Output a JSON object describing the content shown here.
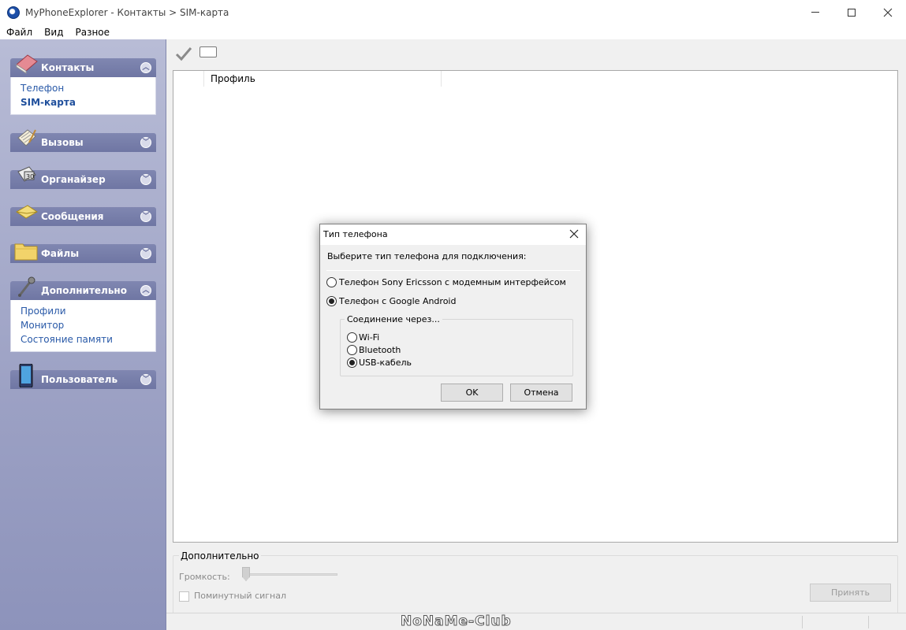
{
  "window": {
    "title": "MyPhoneExplorer -  Контакты > SIM-карта",
    "controls": {
      "minimize": "—",
      "maximize": "☐",
      "close": "✕"
    }
  },
  "menu": [
    "Файл",
    "Вид",
    "Разное"
  ],
  "sidebar": {
    "groups": [
      {
        "label": "Контакты",
        "expanded": true,
        "items": [
          {
            "label": "Телефон",
            "active": false
          },
          {
            "label": "SIM-карта",
            "active": true
          }
        ],
        "icon": "contacts-book-icon"
      },
      {
        "label": "Вызовы",
        "expanded": false,
        "items": [],
        "icon": "calls-notepad-icon"
      },
      {
        "label": "Органайзер",
        "expanded": false,
        "items": [],
        "icon": "organizer-calendar-icon"
      },
      {
        "label": "Сообщения",
        "expanded": false,
        "items": [],
        "icon": "messages-envelope-icon"
      },
      {
        "label": "Файлы",
        "expanded": false,
        "items": [],
        "icon": "files-folder-icon"
      },
      {
        "label": "Дополнительно",
        "expanded": true,
        "items": [
          {
            "label": "Профили",
            "active": false
          },
          {
            "label": "Монитор",
            "active": false
          },
          {
            "label": "Состояние памяти",
            "active": false
          }
        ],
        "icon": "extras-tools-icon"
      },
      {
        "label": "Пользователь",
        "expanded": false,
        "items": [],
        "icon": "user-phone-icon"
      }
    ]
  },
  "toolbar": {
    "icons": [
      "checkmark-icon",
      "rectangle-icon"
    ]
  },
  "list": {
    "columns": [
      "Профиль"
    ]
  },
  "extra_panel": {
    "title": "Дополнительно",
    "volume_label": "Громкость:",
    "minute_signal_label": "Поминутный сигнал",
    "apply_label": "Принять"
  },
  "watermark": "NoNaMe-Club",
  "dialog": {
    "title": "Тип телефона",
    "prompt": "Выберите тип телефона для подключения:",
    "options": [
      {
        "label": "Телефон Sony Ericsson с модемным интерфейсом",
        "checked": false
      },
      {
        "label": "Телефон с Google Android",
        "checked": true
      }
    ],
    "connection": {
      "title": "Соединение через...",
      "options": [
        {
          "label": "Wi-Fi",
          "checked": false
        },
        {
          "label": "Bluetooth",
          "checked": false
        },
        {
          "label": "USB-кабель",
          "checked": true
        }
      ]
    },
    "ok_label": "OK",
    "cancel_label": "Отмена"
  }
}
